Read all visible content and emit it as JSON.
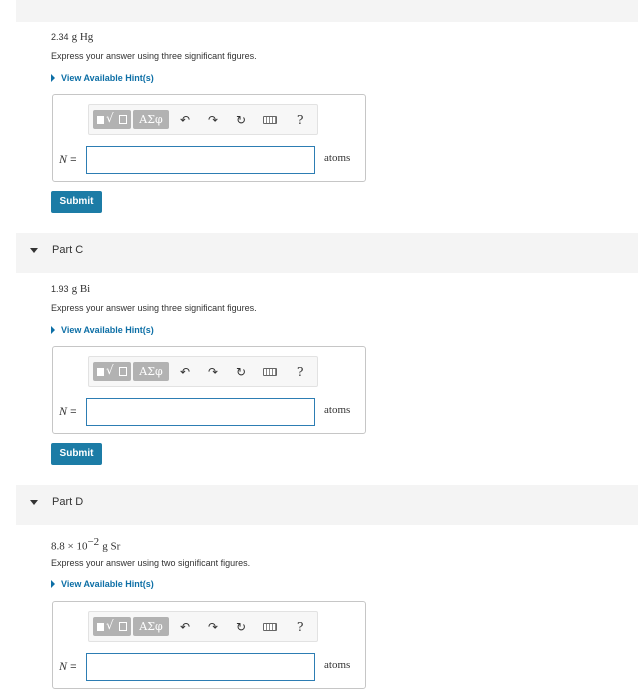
{
  "partB": {
    "problem_num": "2.34",
    "problem_unit": "g Hg",
    "instruction": "Express your answer using three significant figures.",
    "hint": "View Available Hint(s)",
    "answer_label": "N =",
    "answer_var": "N",
    "answer_value": "",
    "answer_unit": "atoms",
    "submit": "Submit"
  },
  "partC": {
    "title": "Part C",
    "problem_num": "1.93",
    "problem_unit": "g Bi",
    "instruction": "Express your answer using three significant figures.",
    "hint": "View Available Hint(s)",
    "answer_var": "N",
    "answer_value": "",
    "answer_unit": "atoms",
    "submit": "Submit"
  },
  "partD": {
    "title": "Part D",
    "problem_mantissa": "8.8 × 10",
    "problem_exponent": "−2",
    "problem_unit": "g Sr",
    "instruction": "Express your answer using two significant figures.",
    "hint": "View Available Hint(s)",
    "answer_var": "N",
    "answer_value": "",
    "answer_unit": "atoms"
  },
  "toolbar": {
    "greek_label": "ΑΣφ",
    "undo_icon": "undo-icon",
    "redo_icon": "redo-icon",
    "reset_icon": "reset-icon",
    "keyboard_icon": "keyboard-icon",
    "help_label": "?"
  },
  "colors": {
    "accent": "#1c7ca6",
    "link": "#0d6fa6",
    "header_bg": "#f4f4f4"
  }
}
